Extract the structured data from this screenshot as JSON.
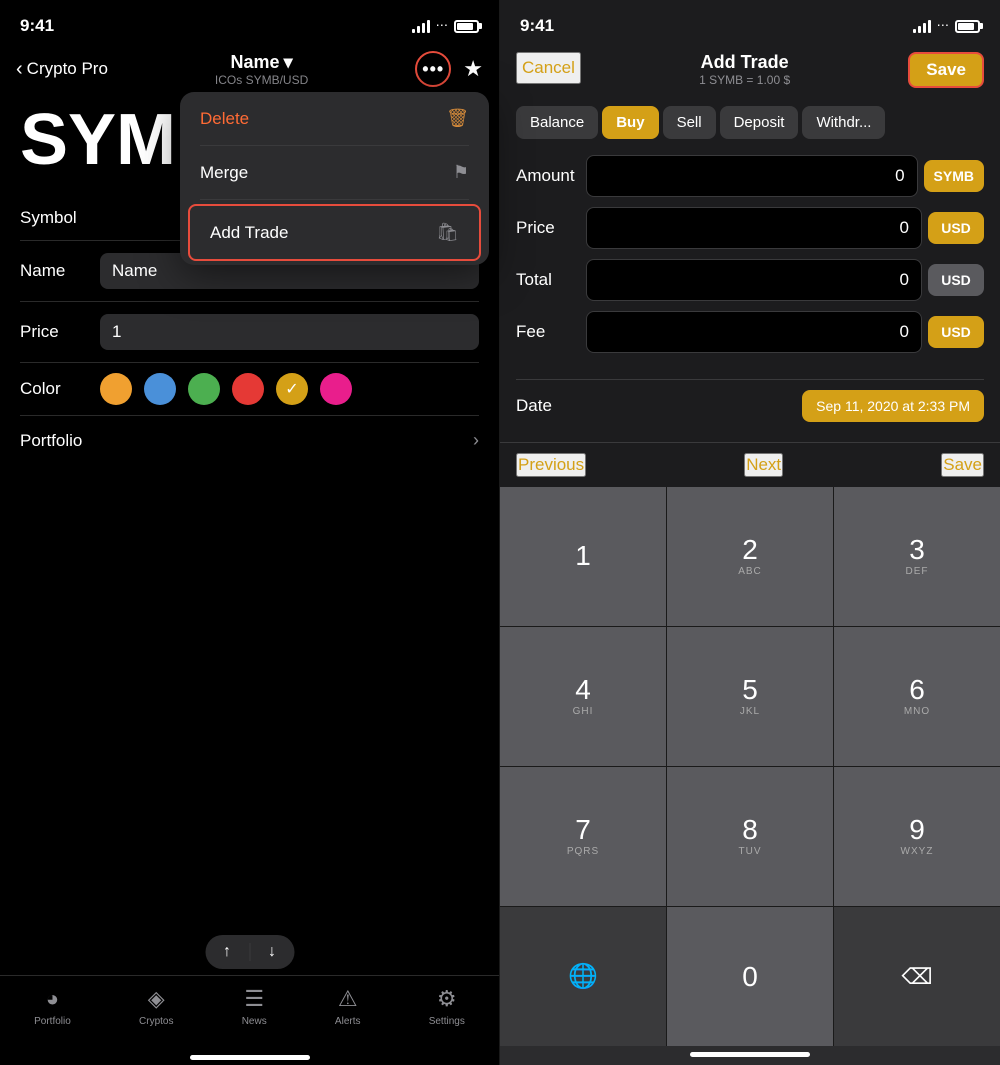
{
  "left": {
    "status": {
      "time": "9:41"
    },
    "nav": {
      "back_label": "Crypto Pro",
      "title": "Name",
      "subtitle": "ICOs SYMB/USD",
      "chevron": "▾"
    },
    "sym_text": "SYM",
    "form": {
      "symbol_label": "Symbol",
      "symbol_value": "",
      "name_label": "Name",
      "name_value": "Name",
      "price_label": "Price",
      "price_value": "1",
      "color_label": "Color",
      "portfolio_label": "Portfolio"
    },
    "dropdown": {
      "delete_label": "Delete",
      "merge_label": "Merge",
      "add_trade_label": "Add Trade"
    },
    "bottom_nav": {
      "items": [
        {
          "label": "Portfolio",
          "icon": "◕"
        },
        {
          "label": "Cryptos",
          "icon": "◈"
        },
        {
          "label": "News",
          "icon": "≡"
        },
        {
          "label": "Alerts",
          "icon": "⚠"
        },
        {
          "label": "Settings",
          "icon": "⚙"
        }
      ]
    },
    "updown": {
      "up": "↑",
      "down": "↓"
    }
  },
  "right": {
    "status": {
      "time": "9:41"
    },
    "nav": {
      "cancel_label": "Cancel",
      "title": "Add Trade",
      "subtitle": "1 SYMB = 1.00 $",
      "save_label": "Save"
    },
    "tabs": [
      {
        "label": "Balance",
        "active": false
      },
      {
        "label": "Buy",
        "active": true
      },
      {
        "label": "Sell",
        "active": false
      },
      {
        "label": "Deposit",
        "active": false
      },
      {
        "label": "Withdr...",
        "active": false
      }
    ],
    "form": {
      "amount_label": "Amount",
      "amount_value": "0",
      "amount_currency": "SYMB",
      "price_label": "Price",
      "price_value": "0",
      "price_currency": "USD",
      "total_label": "Total",
      "total_value": "0",
      "total_currency": "USD",
      "fee_label": "Fee",
      "fee_value": "0",
      "fee_currency": "USD"
    },
    "date": {
      "label": "Date",
      "value": "Sep 11, 2020 at 2:33 PM"
    },
    "toolbar": {
      "previous_label": "Previous",
      "next_label": "Next",
      "save_label": "Save"
    },
    "numpad": [
      {
        "main": "1",
        "sub": ""
      },
      {
        "main": "2",
        "sub": "ABC"
      },
      {
        "main": "3",
        "sub": "DEF"
      },
      {
        "main": "4",
        "sub": "GHI"
      },
      {
        "main": "5",
        "sub": "JKL"
      },
      {
        "main": "6",
        "sub": "MNO"
      },
      {
        "main": "7",
        "sub": "PQRS"
      },
      {
        "main": "8",
        "sub": "TUV"
      },
      {
        "main": "9",
        "sub": "WXYZ"
      },
      {
        "main": ".",
        "sub": ""
      },
      {
        "main": "0",
        "sub": ""
      },
      {
        "main": "⌫",
        "sub": ""
      }
    ]
  }
}
